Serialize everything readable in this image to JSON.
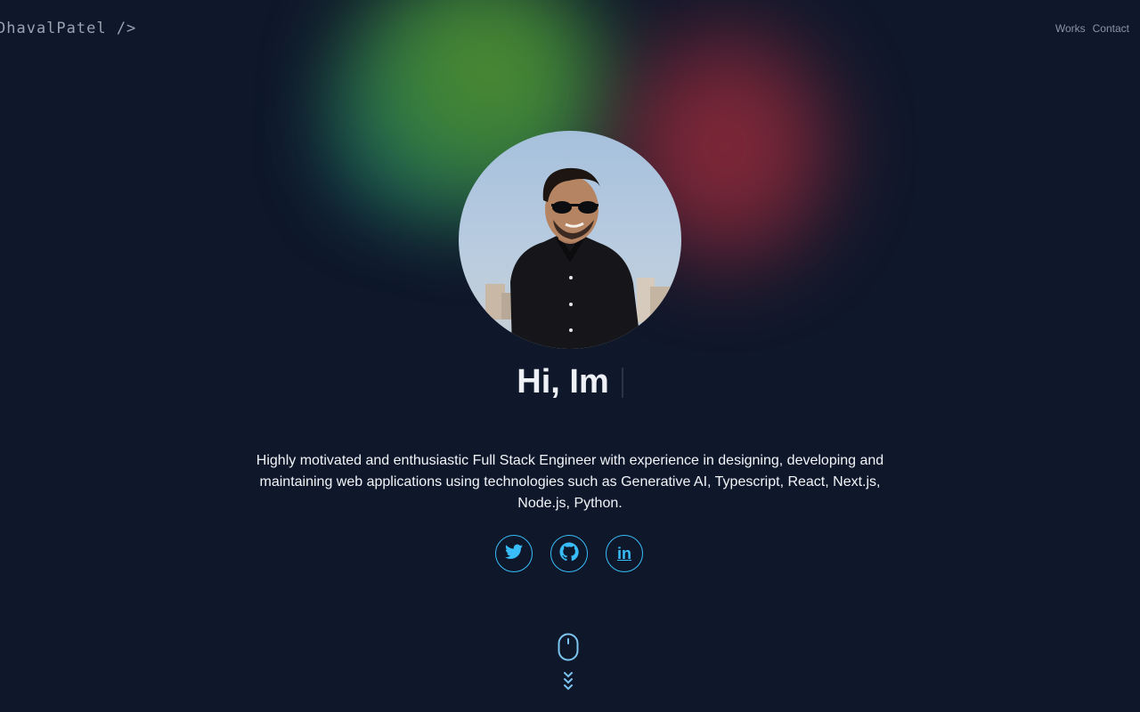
{
  "header": {
    "logo": "DhavalPatel />",
    "nav": [
      "Works",
      "Contact"
    ]
  },
  "hero": {
    "greeting": "Hi, Im",
    "bio": "Highly motivated and enthusiastic Full Stack Engineer with experience in designing, developing and maintaining web applications using technologies such as Generative AI, Typescript, React, Next.js, Node.js, Python."
  },
  "socials": [
    {
      "icon": "twitter-icon"
    },
    {
      "icon": "github-icon"
    },
    {
      "icon": "linkedin-icon",
      "label": "in"
    }
  ],
  "scroll_indicator": {
    "icon": "mouse-icon"
  },
  "colors": {
    "background": "#0f172a",
    "accent": "#38bdf8",
    "text": "#f1f5f9"
  }
}
